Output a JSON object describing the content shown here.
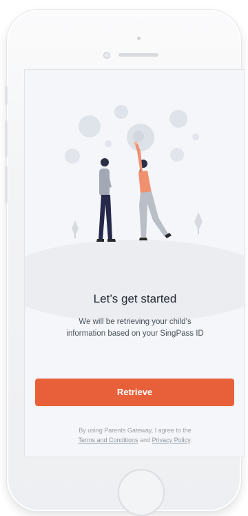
{
  "onboarding": {
    "title": "Let’s get started",
    "subtitle_line1": "We will be retrieving your child’s",
    "subtitle_line2": "information based on your SingPass ID",
    "retrieve_label": "Retrieve",
    "legal_prefix": "By using Parents Gateway, I agree to the",
    "terms_link": "Terms and Conditions",
    "legal_and": "and",
    "privacy_link": "Privacy Policy",
    "legal_suffix": "."
  },
  "colors": {
    "accent": "#e8603a",
    "screen_background": "#f4f6f9",
    "title_text": "#222a33"
  },
  "illustration": {
    "subject": "two-people-reaching-for-bubbles"
  }
}
